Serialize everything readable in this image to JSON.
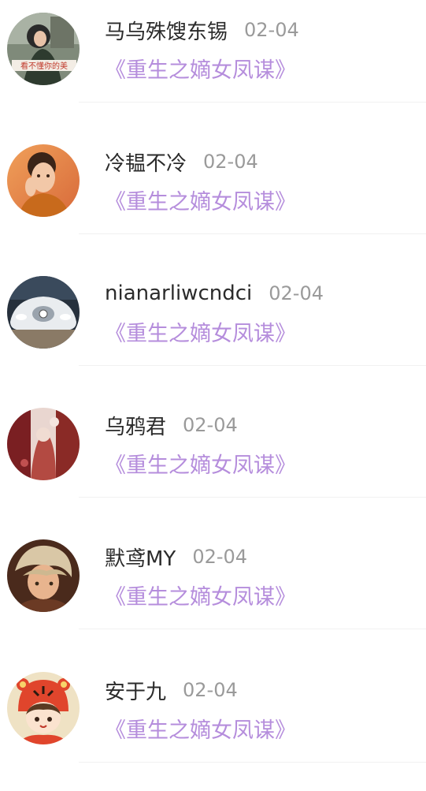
{
  "comments": [
    {
      "user": "马乌殊馊东锡",
      "date": "02-04",
      "book": "《重生之嫡女凤谋》",
      "avatar_icon": "avatar-girl-street-icon"
    },
    {
      "user": "冷韫不冷",
      "date": "02-04",
      "book": "《重生之嫡女凤谋》",
      "avatar_icon": "avatar-girl-orange-icon"
    },
    {
      "user": "nianarliwcndci",
      "date": "02-04",
      "book": "《重生之嫡女凤谋》",
      "avatar_icon": "avatar-sports-car-icon"
    },
    {
      "user": "乌鸦君",
      "date": "02-04",
      "book": "《重生之嫡女凤谋》",
      "avatar_icon": "avatar-anime-art-icon"
    },
    {
      "user": "默鸢MY",
      "date": "02-04",
      "book": "《重生之嫡女凤谋》",
      "avatar_icon": "avatar-anime-boy-icon"
    },
    {
      "user": "安于九",
      "date": "02-04",
      "book": "《重生之嫡女凤谋》",
      "avatar_icon": "avatar-cartoon-tiger-hat-icon"
    }
  ],
  "avatar_caption": "看不懂你的美",
  "colors": {
    "name": "#2b2b2b",
    "date": "#9a9a9a",
    "book_title": "#b58ddc",
    "divider": "#f1f1f1"
  }
}
